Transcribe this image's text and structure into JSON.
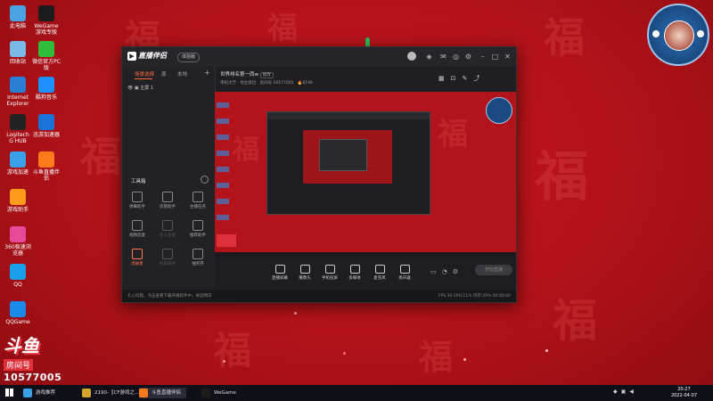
{
  "colors": {
    "accent": "#ff6a3d",
    "desktop_red": "#c8161c",
    "window_bg": "#1f1f23"
  },
  "desktop": {
    "icons": [
      {
        "label": "此电脑",
        "icon": "computer-icon",
        "color": "#4aa3e0"
      },
      {
        "label": "WeGame游戏专版",
        "icon": "wegame-icon",
        "color": "#1c1c1c"
      },
      {
        "label": "回收站",
        "icon": "recycle-bin-icon",
        "color": "#7ab8e8"
      },
      {
        "label": "微信官方PC版",
        "icon": "wechat-icon",
        "color": "#2fbd3a"
      },
      {
        "label": "Internet Explorer",
        "icon": "ie-icon",
        "color": "#2a7fd4"
      },
      {
        "label": "酷狗音乐",
        "icon": "kugou-icon",
        "color": "#1e90ff"
      },
      {
        "label": "Logitech G HUB",
        "icon": "logitech-icon",
        "color": "#222"
      },
      {
        "label": "迅游加速器",
        "icon": "accelerator-icon",
        "color": "#1a74d8"
      },
      {
        "label": "游戏加速",
        "icon": "cloud-icon",
        "color": "#3aa0e8"
      },
      {
        "label": "斗鱼直播伴侣",
        "icon": "douyu-icon",
        "color": "#ff7a1a"
      },
      {
        "label": "游戏助手",
        "icon": "game-assistant-icon",
        "color": "#ff9a1a"
      },
      {
        "label": "360极速浏览器",
        "icon": "browser-icon",
        "color": "#e84a9a"
      },
      {
        "label": "QQ",
        "icon": "qq-icon",
        "color": "#1aa0ea"
      },
      {
        "label": "QQGame",
        "icon": "qqgame-icon",
        "color": "#1a8ae8"
      }
    ]
  },
  "badge": {
    "logo": "斗鱼",
    "subtitle": "房间号",
    "room_number": "10577005"
  },
  "app": {
    "logo_text": "直播伴侣",
    "version_pill": "体验版",
    "left_tabs": [
      "场景选择",
      "源",
      "本地"
    ],
    "scene_label": "主屏 1",
    "toolbox_title": "工具箱",
    "tools": [
      {
        "label": "弹幕助手",
        "state": "normal",
        "icon": "danmaku-icon"
      },
      {
        "label": "房管助手",
        "state": "normal",
        "icon": "admin-icon"
      },
      {
        "label": "主播任务",
        "state": "normal",
        "icon": "task-icon"
      },
      {
        "label": "视频连麦",
        "state": "normal",
        "icon": "video-call-icon"
      },
      {
        "label": "多人连麦",
        "state": "off",
        "icon": "multi-call-icon"
      },
      {
        "label": "推荐助手",
        "state": "normal",
        "icon": "recommend-icon"
      },
      {
        "label": "虎碰星",
        "state": "on",
        "icon": "star-icon"
      },
      {
        "label": "投屏插件",
        "state": "off",
        "icon": "cast-icon"
      },
      {
        "label": "抽奖券",
        "state": "normal",
        "icon": "lottery-icon"
      }
    ],
    "room_title": "世界排名第一西w",
    "room_tag": "修改",
    "room_sub": "单机大厅 · 地主排位",
    "room_id_text": "房间号 10577005",
    "followers": "8199",
    "bottom_buttons": [
      {
        "label": "直播屏幕",
        "icon": "screen-icon"
      },
      {
        "label": "摄像头",
        "icon": "camera-icon"
      },
      {
        "label": "手机投屏",
        "icon": "phone-icon"
      },
      {
        "label": "多媒体",
        "icon": "media-icon"
      },
      {
        "label": "麦克风",
        "icon": "mic-icon"
      },
      {
        "label": "扬声器",
        "icon": "speaker-icon"
      }
    ],
    "start_button": "开始直播",
    "status_left": "扎心问题，点击查看下载开播软件中，奇迹明白",
    "status_right": "FPS:30   CPU:11%   内存:29%   00:00:00"
  },
  "taskbar": {
    "items": [
      {
        "label": "游戏推荐",
        "color": "#3aa0e8"
      },
      {
        "label": "2190-【CF游戏之…",
        "color": "#d4a52a"
      },
      {
        "label": "斗鱼直播伴侣",
        "color": "#ff7a1a"
      },
      {
        "label": "WeGame",
        "color": "#1c1c1c"
      }
    ],
    "time": "20:27",
    "date": "2022-04-07"
  }
}
